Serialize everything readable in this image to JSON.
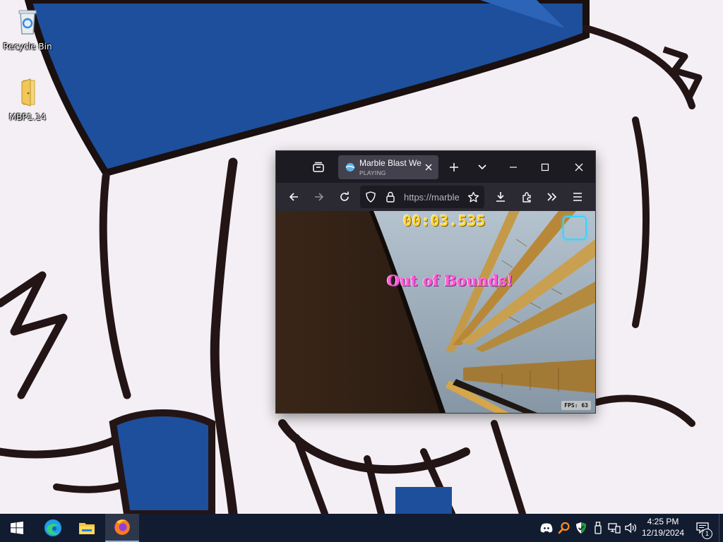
{
  "desktop": {
    "icons": [
      {
        "label": "Recycle Bin",
        "icon": "recycle-bin-icon"
      },
      {
        "label": "MBP1.14",
        "icon": "folder-icon"
      }
    ]
  },
  "browser": {
    "tab": {
      "title": "Marble Blast Web",
      "subtitle": "PLAYING",
      "favicon": "marble-icon"
    },
    "url": "https://marble",
    "window_controls": [
      "minimize-icon",
      "maximize-icon",
      "close-icon"
    ],
    "toolbar_icons": [
      "back-icon",
      "forward-icon",
      "reload-icon",
      "shield-icon",
      "lock-icon",
      "bookmark-star-icon",
      "download-icon",
      "extensions-icon",
      "overflow-icon",
      "menu-icon"
    ]
  },
  "game": {
    "timer": "00:03.535",
    "message": "Out of Bounds!",
    "fps": "FPS: 63",
    "colors": {
      "timer": "#ffd43a",
      "message": "#ff5bd6",
      "powerup": "#38d6ff"
    }
  },
  "taskbar": {
    "pinned": [
      "windows-start-icon",
      "edge-icon",
      "file-explorer-icon",
      "firefox-icon"
    ],
    "tray": [
      "discord-icon",
      "search-tray-icon",
      "defender-icon",
      "usb-icon",
      "network-icon",
      "volume-icon"
    ],
    "time": "4:25 PM",
    "date": "12/19/2024",
    "notification_count": "1"
  }
}
